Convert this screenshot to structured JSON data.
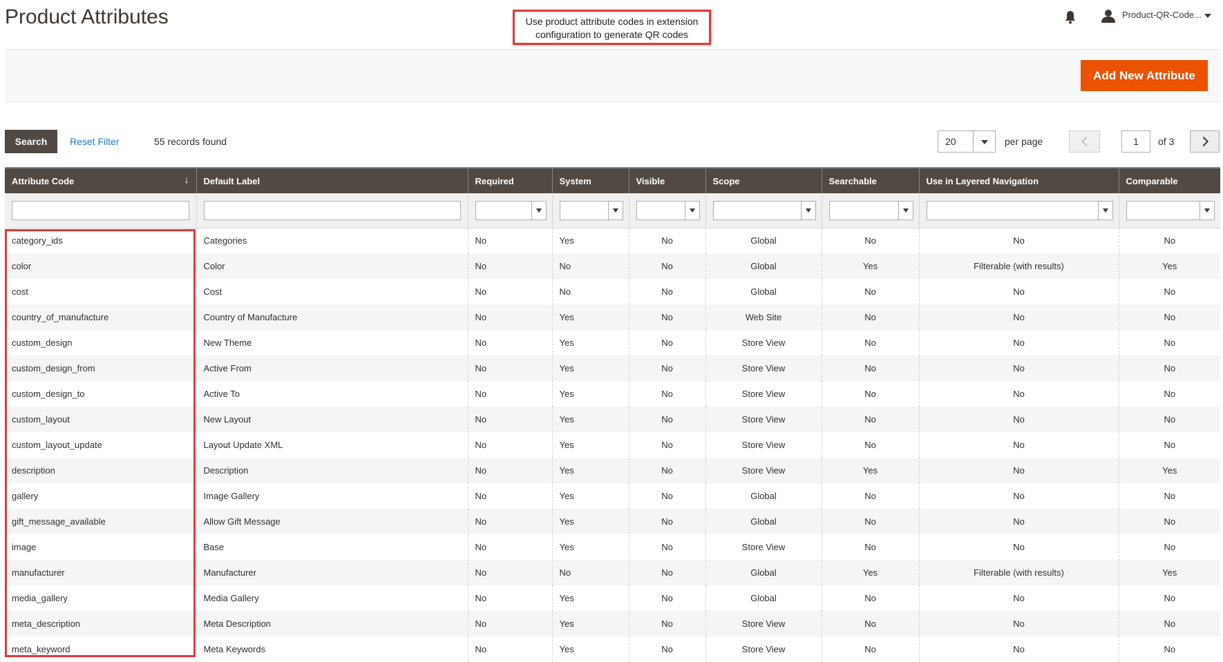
{
  "page": {
    "title": "Product Attributes"
  },
  "callout": {
    "line1": "Use product attribute codes in extension",
    "line2": "configuration to generate QR codes"
  },
  "header": {
    "user_name": "Product-QR-Code..."
  },
  "actions": {
    "add_new_label": "Add New Attribute"
  },
  "toolbar": {
    "search_label": "Search",
    "reset_label": "Reset Filter",
    "records": "55 records found",
    "per_page_value": "20",
    "per_page_label": "per page",
    "current_page": "1",
    "of_pages": "of 3"
  },
  "columns": [
    "Attribute Code",
    "Default Label",
    "Required",
    "System",
    "Visible",
    "Scope",
    "Searchable",
    "Use in Layered Navigation",
    "Comparable"
  ],
  "rows": [
    [
      "category_ids",
      "Categories",
      "No",
      "Yes",
      "No",
      "Global",
      "No",
      "No",
      "No"
    ],
    [
      "color",
      "Color",
      "No",
      "No",
      "No",
      "Global",
      "Yes",
      "Filterable (with results)",
      "Yes"
    ],
    [
      "cost",
      "Cost",
      "No",
      "No",
      "No",
      "Global",
      "No",
      "No",
      "No"
    ],
    [
      "country_of_manufacture",
      "Country of Manufacture",
      "No",
      "Yes",
      "No",
      "Web Site",
      "No",
      "No",
      "No"
    ],
    [
      "custom_design",
      "New Theme",
      "No",
      "Yes",
      "No",
      "Store View",
      "No",
      "No",
      "No"
    ],
    [
      "custom_design_from",
      "Active From",
      "No",
      "Yes",
      "No",
      "Store View",
      "No",
      "No",
      "No"
    ],
    [
      "custom_design_to",
      "Active To",
      "No",
      "Yes",
      "No",
      "Store View",
      "No",
      "No",
      "No"
    ],
    [
      "custom_layout",
      "New Layout",
      "No",
      "Yes",
      "No",
      "Store View",
      "No",
      "No",
      "No"
    ],
    [
      "custom_layout_update",
      "Layout Update XML",
      "No",
      "Yes",
      "No",
      "Store View",
      "No",
      "No",
      "No"
    ],
    [
      "description",
      "Description",
      "No",
      "Yes",
      "No",
      "Store View",
      "Yes",
      "No",
      "Yes"
    ],
    [
      "gallery",
      "Image Gallery",
      "No",
      "Yes",
      "No",
      "Global",
      "No",
      "No",
      "No"
    ],
    [
      "gift_message_available",
      "Allow Gift Message",
      "No",
      "Yes",
      "No",
      "Global",
      "No",
      "No",
      "No"
    ],
    [
      "image",
      "Base",
      "No",
      "Yes",
      "No",
      "Store View",
      "No",
      "No",
      "No"
    ],
    [
      "manufacturer",
      "Manufacturer",
      "No",
      "No",
      "No",
      "Global",
      "Yes",
      "Filterable (with results)",
      "Yes"
    ],
    [
      "media_gallery",
      "Media Gallery",
      "No",
      "Yes",
      "No",
      "Global",
      "No",
      "No",
      "No"
    ],
    [
      "meta_description",
      "Meta Description",
      "No",
      "Yes",
      "No",
      "Store View",
      "No",
      "No",
      "No"
    ],
    [
      "meta_keyword",
      "Meta Keywords",
      "No",
      "Yes",
      "No",
      "Store View",
      "No",
      "No",
      "No"
    ]
  ],
  "colors": {
    "accent": "#eb5202",
    "header_bg": "#514943",
    "link": "#1979c3",
    "highlight": "#e0393b"
  },
  "icons": {
    "bell": "bell-icon",
    "user": "user-icon",
    "sort": "sort-arrow-icon"
  }
}
